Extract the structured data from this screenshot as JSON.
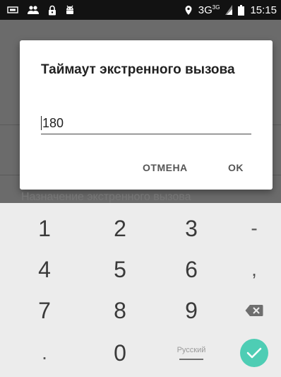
{
  "status_bar": {
    "network_label": "3G",
    "network_sup": "3G",
    "time": "15:15",
    "icons": [
      "storage-icon",
      "people-icon",
      "lock-icon",
      "android-icon",
      "location-icon",
      "signal-icon",
      "battery-icon"
    ]
  },
  "background": {
    "section_label": "Назначение экстренного вызова"
  },
  "dialog": {
    "title": "Таймаут экстренного вызова",
    "input_value": "180",
    "cancel_label": "ОТМЕНА",
    "ok_label": "OK"
  },
  "keyboard": {
    "keys": {
      "k1": "1",
      "k2": "2",
      "k3": "3",
      "minus": "-",
      "k4": "4",
      "k5": "5",
      "k6": "6",
      "comma": ",",
      "k7": "7",
      "k8": "8",
      "k9": "9",
      "period": ".",
      "k0": "0"
    },
    "language_label": "Русский",
    "accent_color": "#4ecdb4"
  }
}
